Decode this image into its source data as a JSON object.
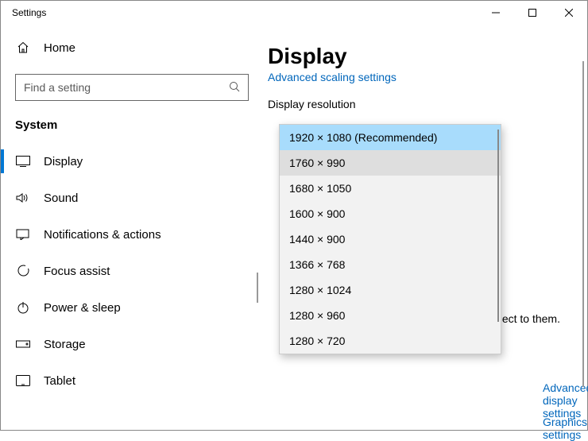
{
  "window": {
    "title": "Settings"
  },
  "sidebar": {
    "home": "Home",
    "search_placeholder": "Find a setting",
    "category": "System",
    "items": [
      {
        "label": "Display"
      },
      {
        "label": "Sound"
      },
      {
        "label": "Notifications & actions"
      },
      {
        "label": "Focus assist"
      },
      {
        "label": "Power & sleep"
      },
      {
        "label": "Storage"
      },
      {
        "label": "Tablet"
      }
    ]
  },
  "main": {
    "title": "Display",
    "scaling_link": "Advanced scaling settings",
    "resolution_label": "Display resolution",
    "truncated": "ect to them.",
    "adv_display_link": "Advanced display settings",
    "graphics_link": "Graphics settings"
  },
  "dropdown": {
    "options": [
      "1920 × 1080 (Recommended)",
      "1760 × 990",
      "1680 × 1050",
      "1600 × 900",
      "1440 × 900",
      "1366 × 768",
      "1280 × 1024",
      "1280 × 960",
      "1280 × 720"
    ],
    "selected_index": 0,
    "hover_index": 1
  }
}
